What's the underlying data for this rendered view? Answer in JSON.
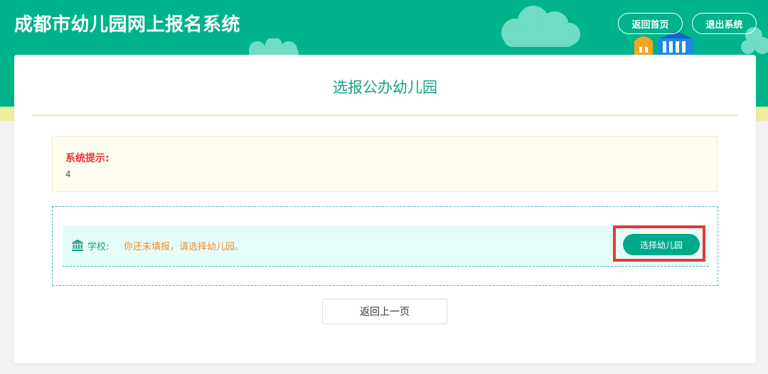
{
  "header": {
    "site_title": "成都市幼儿园网上报名系统",
    "home_label": "返回首页",
    "logout_label": "退出系统"
  },
  "page": {
    "title": "选报公办幼儿园"
  },
  "notice": {
    "title": "系统提示:",
    "body": "4"
  },
  "school": {
    "label": "学校:",
    "value": "你还未填报，请选择幼儿园。",
    "choose_label": "选择幼儿园"
  },
  "footer": {
    "back_label": "返回上一页"
  },
  "icons": {
    "school": "bank-building-icon"
  },
  "colors": {
    "brand": "#00b38a",
    "accent_text": "#16a086",
    "warning_text": "#f08a2a",
    "notice_title": "#e53935",
    "highlight": "#e53935"
  }
}
